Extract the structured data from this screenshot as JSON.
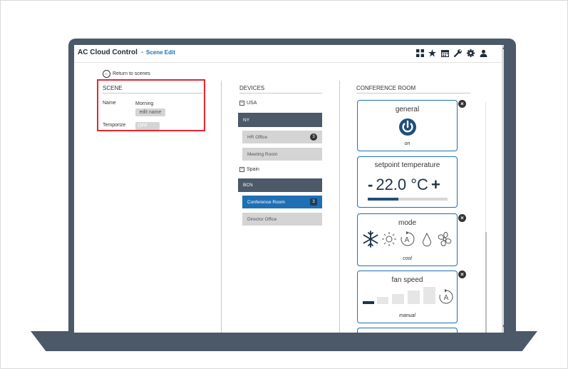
{
  "app": {
    "title": "AC Cloud Control",
    "separator": "-",
    "page": "Scene Edit"
  },
  "toolbar_icons": [
    "grid-icon",
    "star-icon",
    "calendar-icon",
    "wrench-icon",
    "gear-icon",
    "user-icon"
  ],
  "return_link": "Return to scenes",
  "scene": {
    "heading": "SCENE",
    "name_label": "Name",
    "name_value": "Morning",
    "edit_name": "edit name",
    "temporize_label": "Temporize",
    "temporize_value": "OFF"
  },
  "devices": {
    "heading": "DEVICES",
    "groups": [
      {
        "label": "USA",
        "expander": "−"
      },
      {
        "label": "Spain",
        "expander": "−"
      }
    ],
    "rows": [
      {
        "label": "NY"
      },
      {
        "label": "HR Office",
        "badge": "3"
      },
      {
        "label": "Meeting Room"
      },
      {
        "label": "BCN"
      },
      {
        "label": "Conference Room",
        "badge": "3"
      },
      {
        "label": "Director Office"
      }
    ]
  },
  "room": {
    "heading": "CONFERENCE ROOM",
    "cards": {
      "general": {
        "title": "general",
        "status": "on"
      },
      "setpoint": {
        "title": "setpoint temperature",
        "minus": "-",
        "value": "22.0 °C",
        "plus": "+",
        "level": 0.38
      },
      "mode": {
        "title": "mode",
        "status": "cool",
        "icons": [
          "snowflake-icon",
          "sun-icon",
          "auto-icon",
          "drop-icon",
          "fan-icon"
        ]
      },
      "fan": {
        "title": "fan speed",
        "status": "manual",
        "auto": "A"
      }
    }
  },
  "colors": {
    "accent": "#1f6fb5",
    "dark": "#4b5968",
    "highlight": "#e5262e"
  }
}
